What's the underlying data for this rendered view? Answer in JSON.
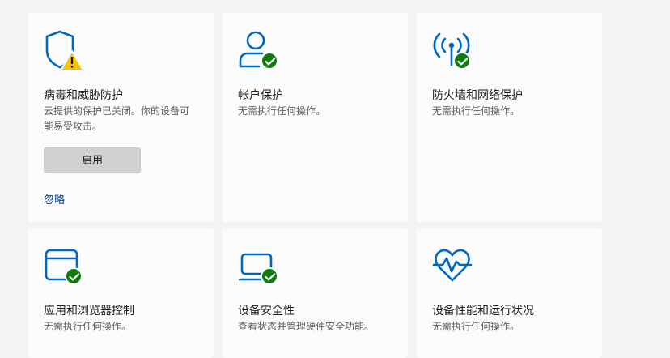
{
  "cards": {
    "virus": {
      "title": "病毒和威胁防护",
      "description": "云提供的保护已关闭。你的设备可能易受攻击。",
      "button_label": "启用",
      "link_label": "忽略",
      "icon": "shield-warning-icon"
    },
    "account": {
      "title": "帐户保护",
      "description": "无需执行任何操作。",
      "icon": "person-icon"
    },
    "firewall": {
      "title": "防火墙和网络保护",
      "description": "无需执行任何操作。",
      "icon": "antenna-icon"
    },
    "app_browser": {
      "title": "应用和浏览器控制",
      "description": "无需执行任何操作。",
      "icon": "browser-window-icon"
    },
    "device_security": {
      "title": "设备安全性",
      "description": "查看状态并管理硬件安全功能。",
      "icon": "laptop-icon"
    },
    "performance": {
      "title": "设备性能和运行状况",
      "description": "无需执行任何操作。",
      "icon": "heart-pulse-icon"
    }
  },
  "colors": {
    "icon_blue": "#0067c0",
    "status_ok": "#0f7b0f",
    "status_warning": "#f7c600",
    "link": "#003e92"
  }
}
